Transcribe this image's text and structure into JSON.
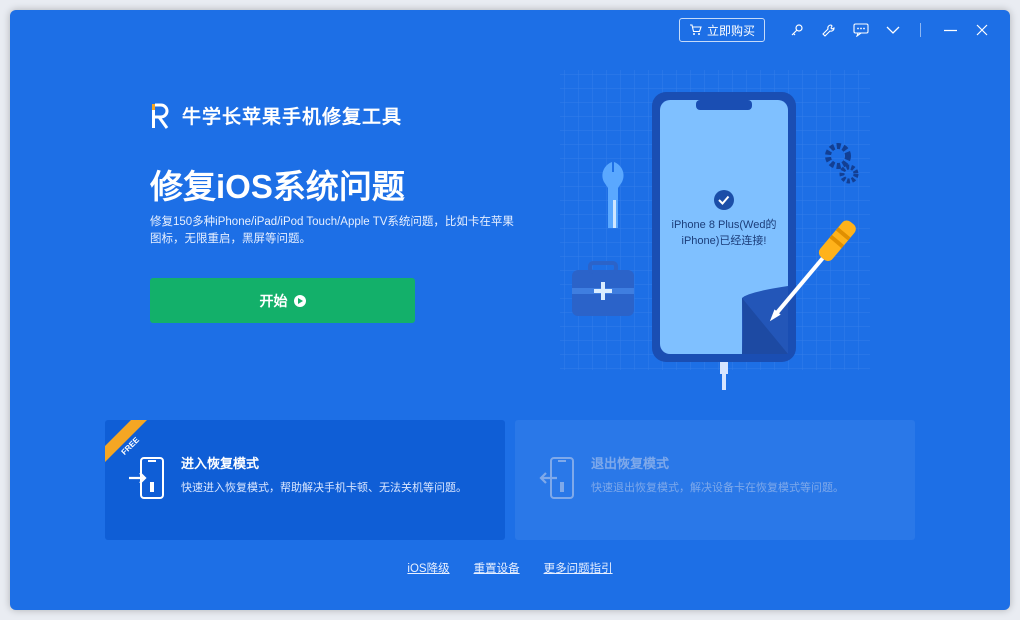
{
  "titlebar": {
    "buy_label": "立即购买",
    "icons": [
      "key-icon",
      "wrench-icon",
      "feedback-icon",
      "dropdown-icon",
      "minimize-icon",
      "close-icon"
    ]
  },
  "brand": {
    "name": "牛学长苹果手机修复工具"
  },
  "main": {
    "headline": "修复iOS系统问题",
    "description": "修复150多种iPhone/iPad/iPod Touch/Apple TV系统问题，比如卡在苹果图标，无限重启，黑屏等问题。",
    "start_label": "开始"
  },
  "device": {
    "status": "iPhone 8 Plus(Wed的iPhone)已经连接!"
  },
  "cards": {
    "enter": {
      "badge": "FREE",
      "title": "进入恢复模式",
      "desc": "快速进入恢复模式，帮助解决手机卡顿、无法关机等问题。"
    },
    "exit": {
      "title": "退出恢复模式",
      "desc": "快速退出恢复模式，解决设备卡在恢复模式等问题。"
    }
  },
  "links": {
    "downgrade": "iOS降级",
    "reset": "重置设备",
    "guide": "更多问题指引"
  },
  "colors": {
    "background": "#1d6fe6",
    "start_button": "#13b06a",
    "card_active": "#0f5ed6",
    "badge": "#f5a623"
  }
}
